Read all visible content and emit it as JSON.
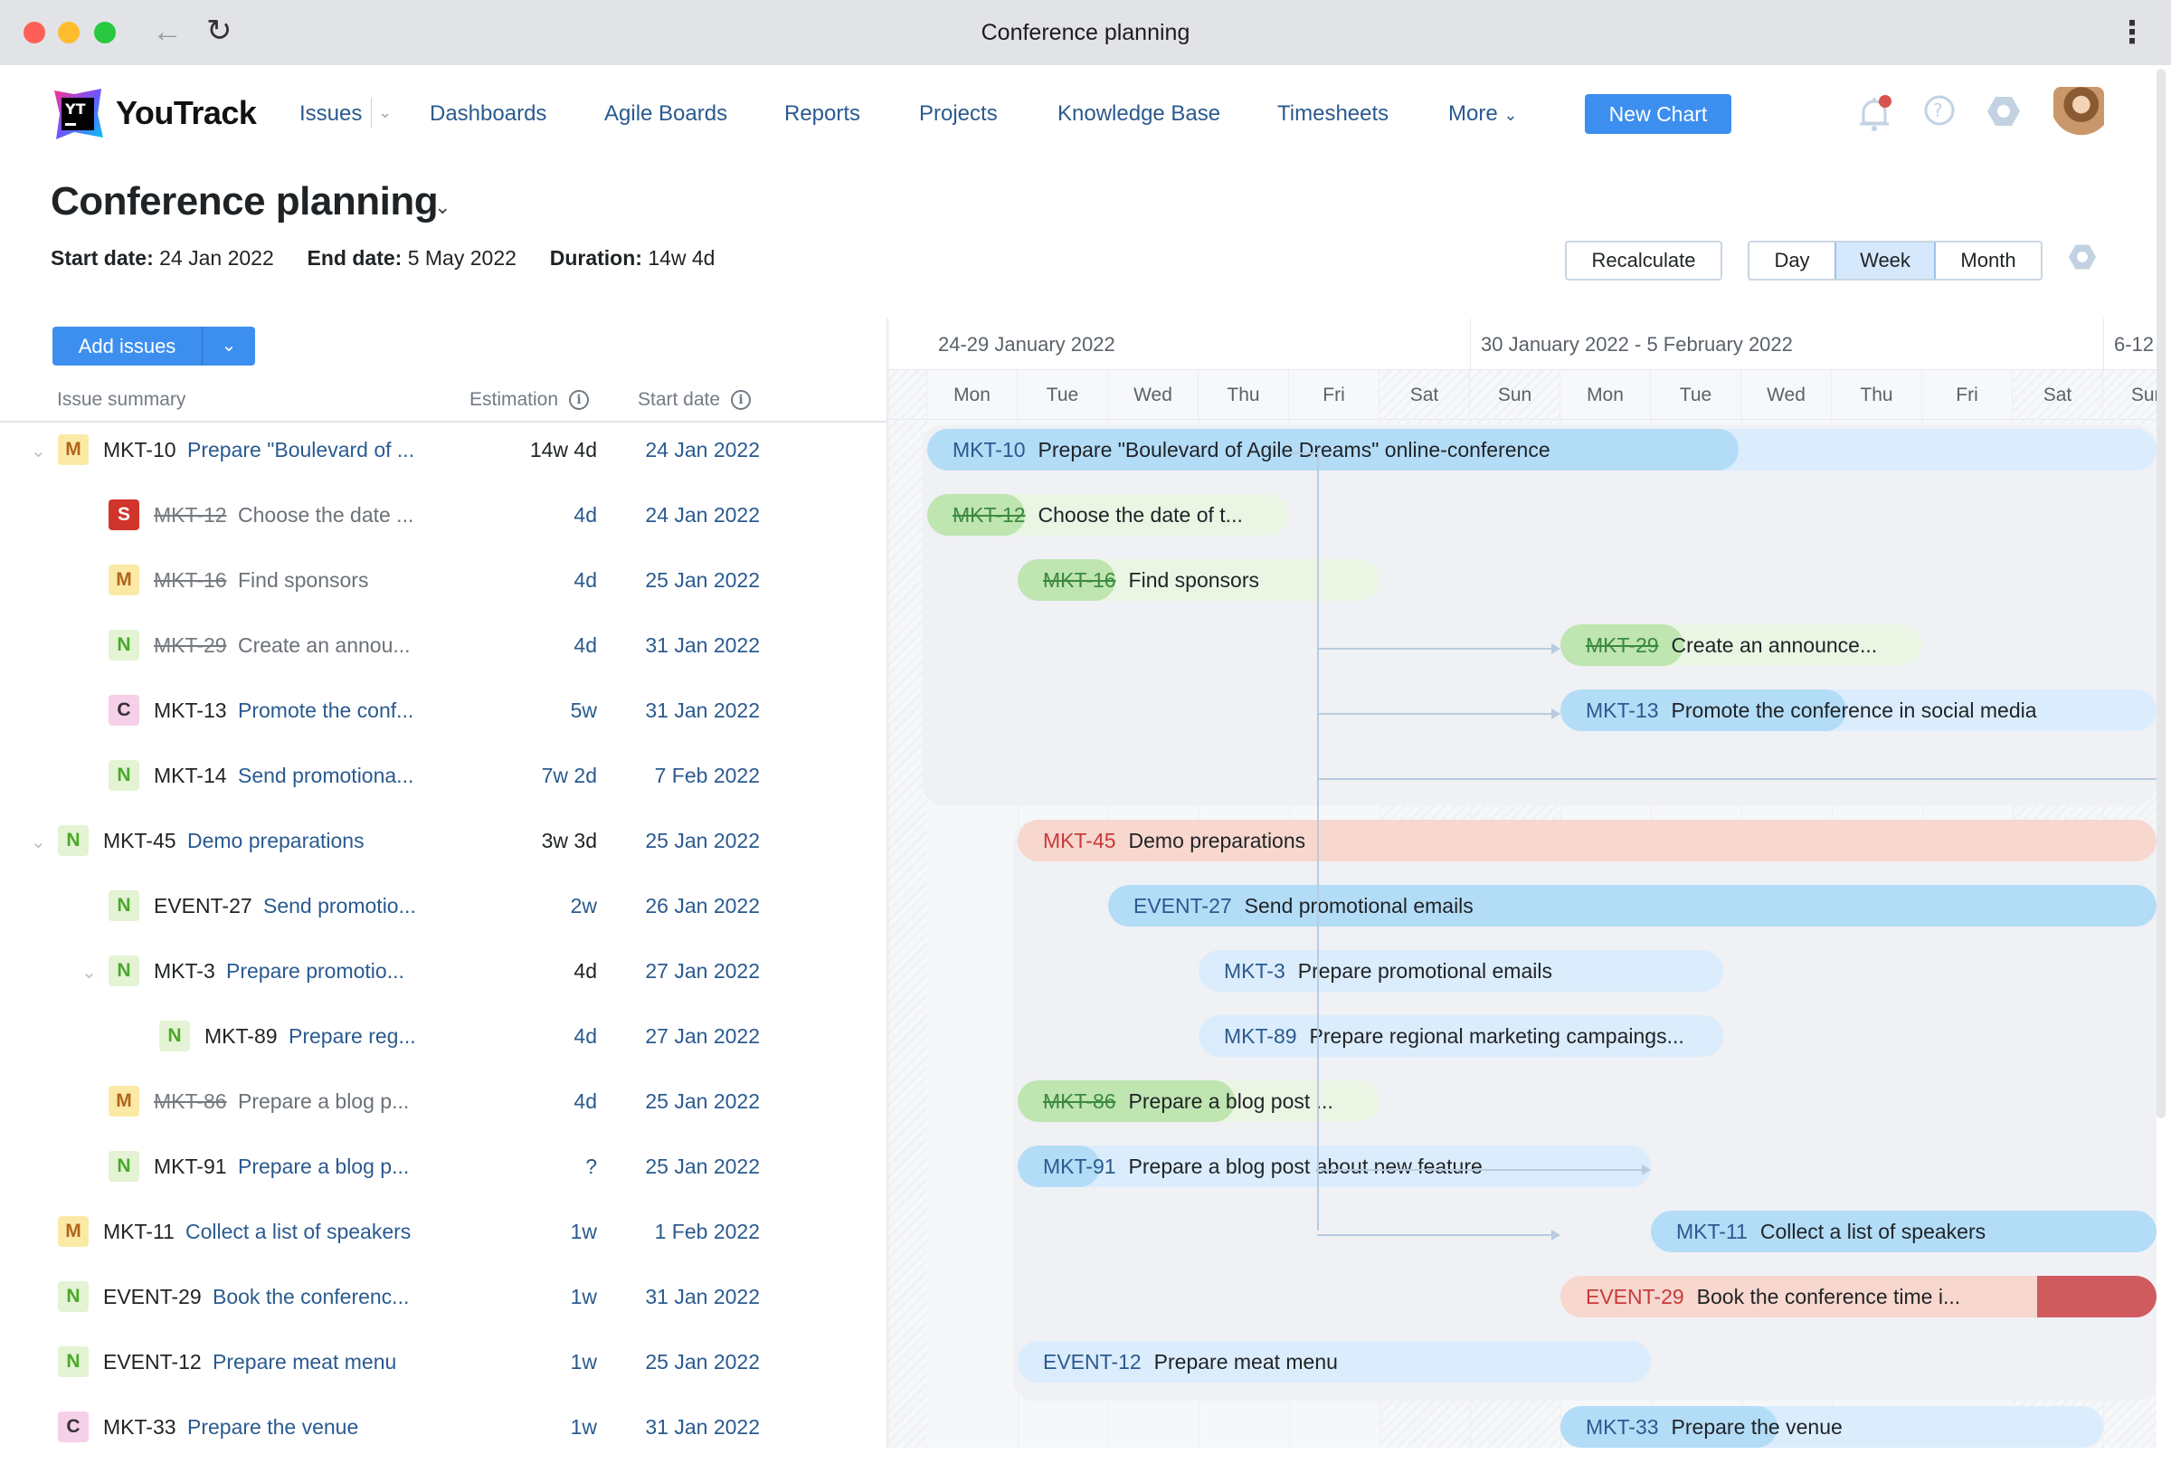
{
  "window": {
    "title": "Conference planning"
  },
  "nav": {
    "brand": "YouTrack",
    "items": [
      "Issues",
      "Dashboards",
      "Agile Boards",
      "Reports",
      "Projects",
      "Knowledge Base",
      "Timesheets",
      "More"
    ],
    "new_chart": "New Chart"
  },
  "page": {
    "title": "Conference planning",
    "start_label": "Start date:",
    "start_value": "24 Jan 2022",
    "end_label": "End date:",
    "end_value": "5 May 2022",
    "duration_label": "Duration:",
    "duration_value": "14w 4d"
  },
  "toolbar": {
    "recalculate": "Recalculate",
    "scale_options": [
      "Day",
      "Week",
      "Month"
    ],
    "scale_selected": "Week",
    "add_issues": "Add issues"
  },
  "columns": {
    "summary": "Issue summary",
    "estimation": "Estimation",
    "start_date": "Start date"
  },
  "issues": [
    {
      "id": "MKT-10",
      "summary": "Prepare \"Boulevard of ...",
      "priority": "M",
      "estimation": "14w 4d",
      "start": "24 Jan 2022",
      "level": 0,
      "expanded": true,
      "done": false,
      "parent": true
    },
    {
      "id": "MKT-12",
      "summary": "Choose the date ...",
      "priority": "S",
      "estimation": "4d",
      "start": "24 Jan 2022",
      "level": 1,
      "done": true
    },
    {
      "id": "MKT-16",
      "summary": "Find sponsors",
      "priority": "M",
      "estimation": "4d",
      "start": "25 Jan 2022",
      "level": 1,
      "done": true
    },
    {
      "id": "MKT-29",
      "summary": "Create an annou...",
      "priority": "N",
      "estimation": "4d",
      "start": "31 Jan 2022",
      "level": 1,
      "done": true
    },
    {
      "id": "MKT-13",
      "summary": "Promote the conf...",
      "priority": "C",
      "estimation": "5w",
      "start": "31 Jan 2022",
      "level": 1,
      "done": false
    },
    {
      "id": "MKT-14",
      "summary": "Send promotiona...",
      "priority": "N",
      "estimation": "7w 2d",
      "start": "7 Feb 2022",
      "level": 1,
      "done": false
    },
    {
      "id": "MKT-45",
      "summary": "Demo preparations",
      "priority": "N",
      "estimation": "3w 3d",
      "start": "25 Jan 2022",
      "level": 0,
      "expanded": true,
      "done": false,
      "parent": true
    },
    {
      "id": "EVENT-27",
      "summary": "Send promotio...",
      "priority": "N",
      "estimation": "2w",
      "start": "26 Jan 2022",
      "level": 1,
      "done": false
    },
    {
      "id": "MKT-3",
      "summary": "Prepare promotio...",
      "priority": "N",
      "estimation": "4d",
      "start": "27 Jan 2022",
      "level": 1,
      "expanded": true,
      "done": false,
      "parent": true
    },
    {
      "id": "MKT-89",
      "summary": "Prepare reg...",
      "priority": "N",
      "estimation": "4d",
      "start": "27 Jan 2022",
      "level": 2,
      "done": false
    },
    {
      "id": "MKT-86",
      "summary": "Prepare a blog p...",
      "priority": "M",
      "estimation": "4d",
      "start": "25 Jan 2022",
      "level": 1,
      "done": true
    },
    {
      "id": "MKT-91",
      "summary": "Prepare a blog p...",
      "priority": "N",
      "estimation": "?",
      "start": "25 Jan 2022",
      "level": 1,
      "done": false
    },
    {
      "id": "MKT-11",
      "summary": "Collect a list of speakers",
      "priority": "M",
      "estimation": "1w",
      "start": "1 Feb 2022",
      "level": 0,
      "done": false
    },
    {
      "id": "EVENT-29",
      "summary": "Book the conferenc...",
      "priority": "N",
      "estimation": "1w",
      "start": "31 Jan 2022",
      "level": 0,
      "done": false
    },
    {
      "id": "EVENT-12",
      "summary": "Prepare meat menu",
      "priority": "N",
      "estimation": "1w",
      "start": "25 Jan 2022",
      "level": 0,
      "done": false
    },
    {
      "id": "MKT-33",
      "summary": "Prepare the venue",
      "priority": "C",
      "estimation": "1w",
      "start": "31 Jan 2022",
      "level": 0,
      "done": false
    }
  ],
  "timeline": {
    "weeks": [
      "24-29 January 2022",
      "30 January 2022 - 5 February 2022",
      "6-12"
    ],
    "days": [
      "Mon",
      "Tue",
      "Wed",
      "Thu",
      "Fri",
      "Sat",
      "Sun",
      "Mon",
      "Tue",
      "Wed",
      "Thu",
      "Fri",
      "Sat",
      "Sun"
    ],
    "bars": [
      {
        "id": "MKT-10",
        "text": "Prepare \"Boulevard of Agile Dreams\" online-conference",
        "color": "blue",
        "done": false
      },
      {
        "id": "MKT-12",
        "text": "Choose the date of t...",
        "color": "green",
        "done": true
      },
      {
        "id": "MKT-16",
        "text": "Find sponsors",
        "color": "green",
        "done": true
      },
      {
        "id": "MKT-29",
        "text": "Create an announce...",
        "color": "green",
        "done": true
      },
      {
        "id": "MKT-13",
        "text": "Promote the conference in social media",
        "color": "blue",
        "done": false
      },
      {
        "id": "MKT-45",
        "text": "Demo preparations",
        "color": "red",
        "done": false
      },
      {
        "id": "EVENT-27",
        "text": "Send promotional emails",
        "color": "blue",
        "done": false
      },
      {
        "id": "MKT-3",
        "text": "Prepare promotional emails",
        "color": "blue",
        "done": false
      },
      {
        "id": "MKT-89",
        "text": "Prepare regional marketing campaings...",
        "color": "blue",
        "done": false
      },
      {
        "id": "MKT-86",
        "text": "Prepare a blog post ...",
        "color": "green",
        "done": true
      },
      {
        "id": "MKT-91",
        "text": "Prepare a blog post about new feature",
        "color": "blue",
        "done": false
      },
      {
        "id": "MKT-11",
        "text": "Collect a list of speakers",
        "color": "blue",
        "done": false
      },
      {
        "id": "EVENT-29",
        "text": "Book the conference time i...",
        "color": "red",
        "done": false
      },
      {
        "id": "EVENT-12",
        "text": "Prepare meat menu",
        "color": "blue",
        "done": false
      },
      {
        "id": "MKT-33",
        "text": "Prepare the venue",
        "color": "blue",
        "done": false
      }
    ]
  },
  "colors": {
    "accent": "#3d8fef",
    "link": "#2a5a8f",
    "overdue": "#cf5b5f"
  }
}
